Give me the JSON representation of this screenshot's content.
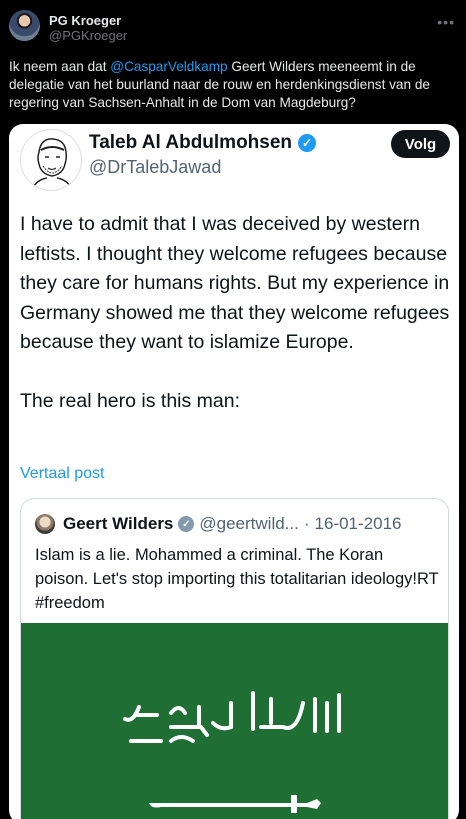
{
  "outer_tweet": {
    "author_name": "PG Kroeger",
    "author_handle": "@PGKroeger",
    "more_icon": "more-icon",
    "text_before_mention": "Ik neem aan dat ",
    "mention": "@CasparVeldkamp",
    "text_after_mention": " Geert Wilders meeneemt in de delegatie van het buurland naar de rouw en herdenkingsdienst van de regering van Sachsen-Anhalt in de Dom van Magdeburg?"
  },
  "embedded_tweet": {
    "author_name": "Taleb Al Abdulmohsen",
    "author_handle": "@DrTalebJawad",
    "follow_label": "Volg",
    "text": "I have to admit that I was deceived by western leftists. I thought they welcome refugees because they care for humans rights. But my experience in Germany showed me that they welcome refugees because they want to islamize Europe.\n\nThe real hero is this man:",
    "translate_label": "Vertaal post",
    "verified_icon": "verified-badge-icon",
    "colors": {
      "verified": "#1d9bf0",
      "link": "#1d9bf0",
      "card_bg": "#ffffff"
    }
  },
  "quoted_tweet": {
    "author_name": "Geert Wilders",
    "author_handle": "@geertwild...",
    "separator": "·",
    "date": "16-01-2016",
    "text": "Islam is a lie. Mohammed a criminal. The Koran poison. Let's stop importing this totalitarian ideology!RT  #freedom",
    "image": {
      "description_icon": "saudi-flag-image",
      "color": "#1f6e34"
    }
  }
}
